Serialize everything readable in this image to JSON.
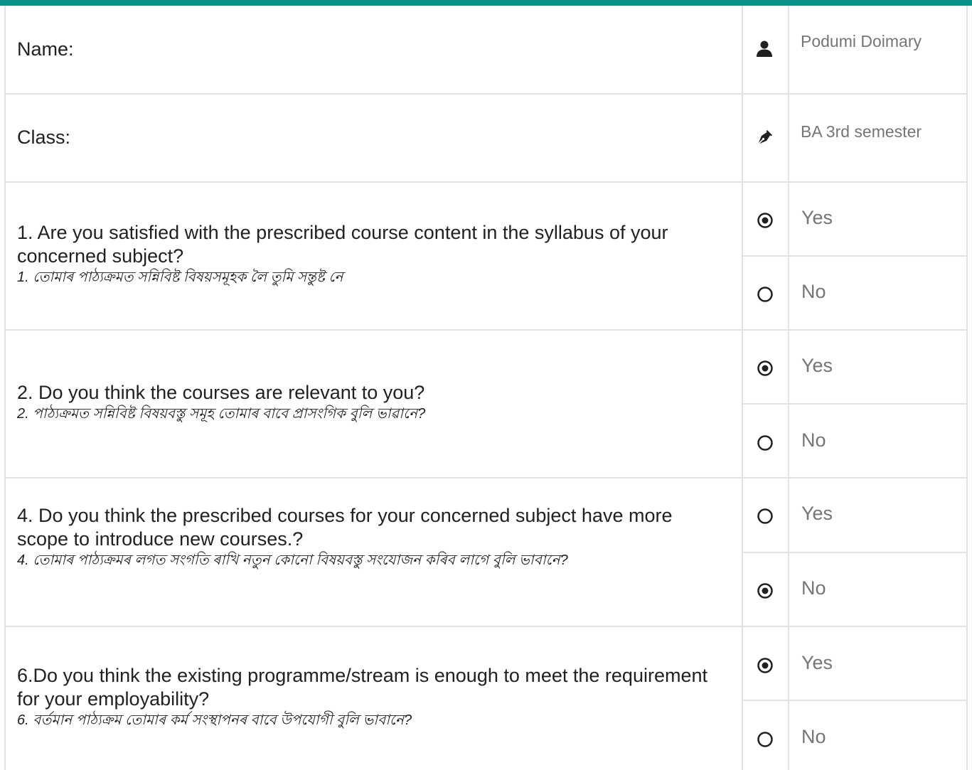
{
  "student": {
    "name_label": "Name:",
    "name_value": "Podumi Doimary",
    "class_label": "Class:",
    "class_value": "BA 3rd semester"
  },
  "questions": [
    {
      "text": "1. Are you satisfied with the prescribed course content in the syllabus of your concerned subject?",
      "translation": "1. তোমাৰ পাঠ্যক্ৰমত সন্নিবিষ্ট বিষয়সমূহক লৈ তুমি সন্তুষ্ট নে",
      "options": [
        {
          "label": "Yes",
          "selected": true
        },
        {
          "label": "No",
          "selected": false
        }
      ]
    },
    {
      "text": "2. Do you think the courses are relevant to you?",
      "translation": "2. পাঠ্যক্ৰমত সন্নিবিষ্ট বিষয়বস্তু সমূহ তোমাৰ বাবে প্ৰাসংগিক বুলি ভাৱানে?",
      "options": [
        {
          "label": "Yes",
          "selected": true
        },
        {
          "label": "No",
          "selected": false
        }
      ]
    },
    {
      "text": "4. Do you think the prescribed courses for your concerned subject have more scope to introduce new courses.?",
      "translation": "4. তোমাৰ পাঠ্যক্ৰমৰ লগত সংগতি ৰাখি নতুন কোনো বিষয়বস্তু সংযোজন কৰিব লাগে বুলি ভাবানে?",
      "options": [
        {
          "label": "Yes",
          "selected": false
        },
        {
          "label": "No",
          "selected": true
        }
      ]
    },
    {
      "text": "6.Do you think the existing programme/stream is enough to meet the requirement for your employability?",
      "translation": "6. বৰ্তমান পাঠ্যক্ৰম তোমাৰ কৰ্ম সংস্থাপনৰ বাবে উপযোগী বুলি ভাবানে?",
      "options": [
        {
          "label": "Yes",
          "selected": true
        },
        {
          "label": "No",
          "selected": false
        }
      ]
    }
  ],
  "icons": {
    "name": "user-icon",
    "class": "pen-nib-icon",
    "selected": "radio-checked-icon",
    "unselected": "radio-unchecked-icon"
  },
  "colors": {
    "accent": "#0a9488",
    "border": "#e2e2e2",
    "value_text": "#757575"
  }
}
